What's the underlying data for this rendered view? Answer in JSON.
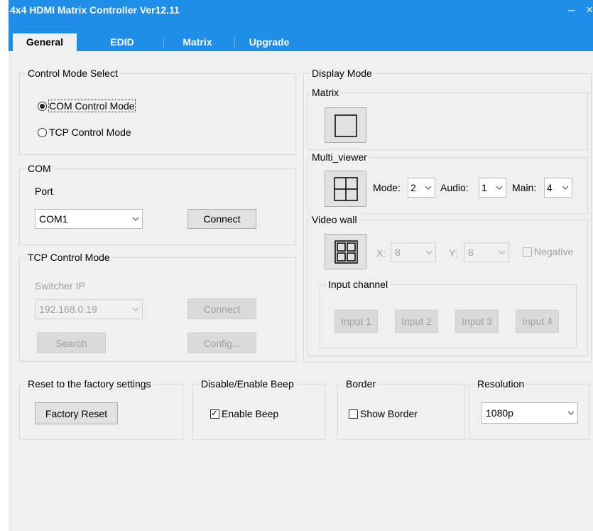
{
  "window": {
    "title": "4x4 HDMI Matrix Controller Ver12.11",
    "minimize_glyph": "–",
    "close_glyph": "×"
  },
  "tabs": [
    {
      "label": "General",
      "active": true
    },
    {
      "label": "EDID",
      "active": false
    },
    {
      "label": "Matrix",
      "active": false
    },
    {
      "label": "Upgrade",
      "active": false
    }
  ],
  "control_mode": {
    "title": "Control Mode Select",
    "com_option": "COM Control Mode",
    "tcp_option": "TCP Control Mode",
    "selected": "com"
  },
  "com": {
    "title": "COM",
    "port_label": "Port",
    "port_value": "COM1",
    "connect_label": "Connect"
  },
  "tcp": {
    "title": "TCP Control Mode",
    "ip_label": "Switcher IP",
    "ip_value": "192.168.0.19",
    "connect_label": "Connect",
    "search_label": "Search",
    "config_label": "Config..."
  },
  "display_mode": {
    "title": "Display Mode",
    "matrix": {
      "title": "Matrix"
    },
    "multi_viewer": {
      "title": "Multi_viewer",
      "mode_label": "Mode:",
      "mode_value": "2",
      "audio_label": "Audio:",
      "audio_value": "1",
      "main_label": "Main:",
      "main_value": "4"
    },
    "video_wall": {
      "title": "Video wall",
      "x_label": "X:",
      "x_value": "8",
      "y_label": "Y:",
      "y_value": "8",
      "negative_label": "Negative",
      "input_channel_title": "Input channel",
      "inputs": [
        "Input 1",
        "Input 2",
        "Input 3",
        "Input 4"
      ]
    }
  },
  "reset": {
    "title": "Reset to the factory settings",
    "button_label": "Factory Reset"
  },
  "beep": {
    "title": "Disable/Enable Beep",
    "checkbox_label": "Enable Beep",
    "checked": true
  },
  "border": {
    "title": "Border",
    "checkbox_label": "Show Border",
    "checked": false
  },
  "resolution": {
    "title": "Resolution",
    "value": "1080p"
  },
  "colors": {
    "titlebar": "#1e8ee8",
    "background": "#f0f0f0",
    "disabled_text": "#a0a0a0"
  },
  "icons": {
    "dropdown": "chevron-down-icon",
    "matrix_mode": "single-square-icon",
    "multiviewer_mode": "quad-grid-icon",
    "videowall_mode": "grid-tiles-icon"
  }
}
